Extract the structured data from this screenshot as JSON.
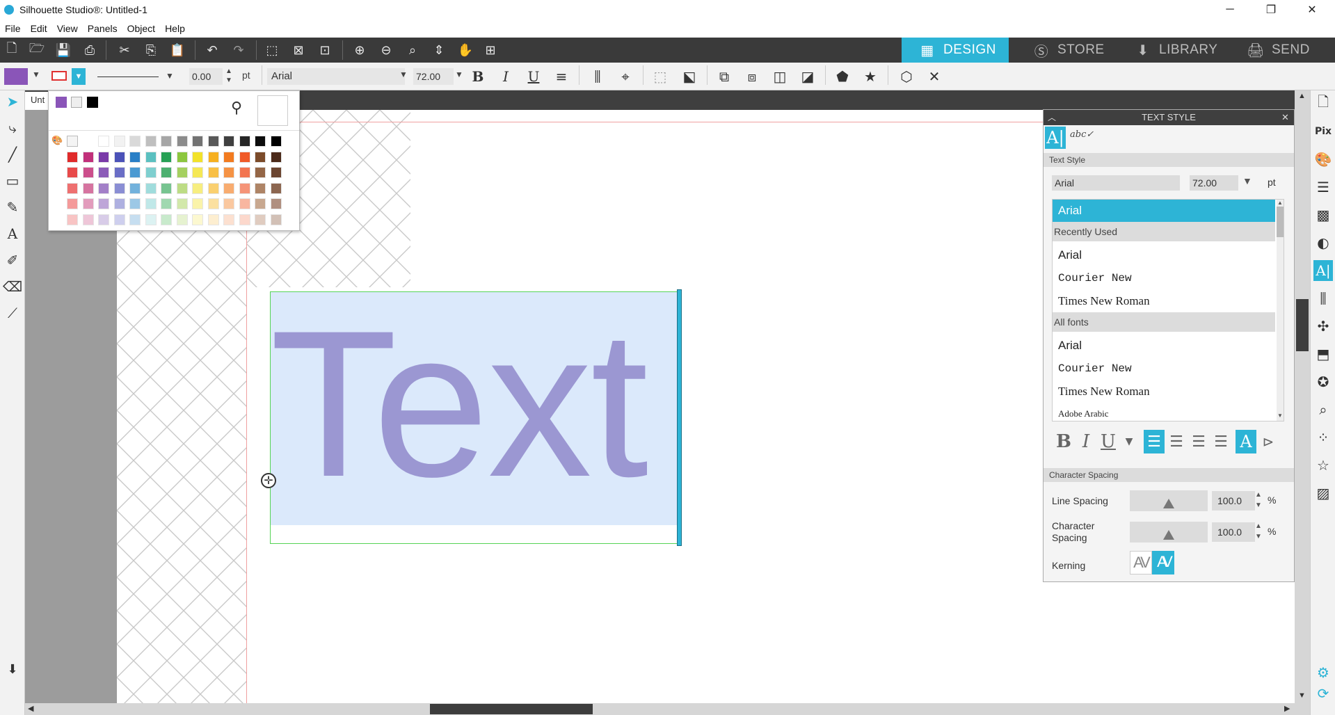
{
  "window": {
    "title": "Silhouette Studio®: Untitled-1",
    "minimize": "─",
    "restore": "❐",
    "close": "✕"
  },
  "menu": [
    "File",
    "Edit",
    "View",
    "Panels",
    "Object",
    "Help"
  ],
  "nav_tabs": [
    {
      "label": "DESIGN",
      "icon": "grid-icon",
      "active": true
    },
    {
      "label": "STORE",
      "icon": "silhouette-s-icon",
      "active": false
    },
    {
      "label": "LIBRARY",
      "icon": "download-icon",
      "active": false
    },
    {
      "label": "SEND",
      "icon": "cutter-icon",
      "active": false
    }
  ],
  "toolbar2": {
    "fill_color": "#8a55b8",
    "line_weight": "0.00",
    "line_unit": "pt",
    "font": "Arial",
    "font_size": "72.00",
    "bold": "B",
    "italic": "I",
    "underline": "U"
  },
  "doc_tab": "Unt",
  "canvas": {
    "text": "Text",
    "text_color": "#9b97d2",
    "selection_color": "#dbe9fb"
  },
  "color_popup": {
    "top_swatches": [
      "#8a55b8",
      "transparent",
      "#000000"
    ],
    "grid": [
      [
        "#ffffff",
        "#f2f2f2",
        "#d9d9d9",
        "#bfbfbf",
        "#a6a6a6",
        "#8c8c8c",
        "#737373",
        "#595959",
        "#404040",
        "#262626",
        "#0d0d0d",
        "#000000"
      ],
      [
        "#e02b2b",
        "#c1307a",
        "#7a3aa8",
        "#4b52b8",
        "#2a7fc6",
        "#5bc0c0",
        "#27a055",
        "#8cc63f",
        "#f2e22a",
        "#f6b020",
        "#f27b20",
        "#f05a28",
        "#7b4b2a",
        "#4b2a1a"
      ],
      [
        "#e84a4a",
        "#cc4f8c",
        "#8c5cb8",
        "#6a6ec6",
        "#4b9ad2",
        "#7fcfcf",
        "#4db070",
        "#a5d060",
        "#f5e855",
        "#f8c045",
        "#f59345",
        "#f27550",
        "#946646",
        "#6b4530"
      ],
      [
        "#ee7070",
        "#d674a0",
        "#a380c8",
        "#8a8ed4",
        "#73b2dc",
        "#a0dcdc",
        "#77c490",
        "#bddc85",
        "#f7ee80",
        "#fad070",
        "#f8ac70",
        "#f59478",
        "#ae8466",
        "#8c6650"
      ],
      [
        "#f49a9a",
        "#e29cbc",
        "#bea6d8",
        "#aeb0e0",
        "#9cc8e6",
        "#c0e8e8",
        "#a0d8b0",
        "#d2e8aa",
        "#faf3aa",
        "#fbe0a0",
        "#fac8a0",
        "#f8b6a0",
        "#c8a890",
        "#b09080"
      ],
      [
        "#f8c4c4",
        "#eec6d8",
        "#d8cce8",
        "#cecfee",
        "#c6def0",
        "#dcf2f2",
        "#c8eacc",
        "#e6f2d0",
        "#fcf8d0",
        "#fdeed0",
        "#fce0d0",
        "#fcd8cc",
        "#e0ccc0",
        "#d2c0b6"
      ]
    ]
  },
  "text_style_panel": {
    "title": "TEXT STYLE",
    "section_text_style": "Text Style",
    "font_field": "Arial",
    "size_field": "72.00",
    "size_unit": "pt",
    "selected_font": "Arial",
    "recently_used_label": "Recently Used",
    "recently_used": [
      "Arial",
      "Courier New",
      "Times New Roman"
    ],
    "all_fonts_label": "All fonts",
    "all_fonts": [
      "Arial",
      "Courier New",
      "Times New Roman",
      "Adobe Arabic"
    ],
    "section_char_spacing": "Character Spacing",
    "line_spacing_label": "Line Spacing",
    "line_spacing_value": "100.0",
    "char_spacing_label": "Character Spacing",
    "char_spacing_value": "100.0",
    "percent": "%",
    "kerning_label": "Kerning",
    "kerning_off": "AV",
    "kerning_on": "AV",
    "accent": "#2db4d6"
  }
}
